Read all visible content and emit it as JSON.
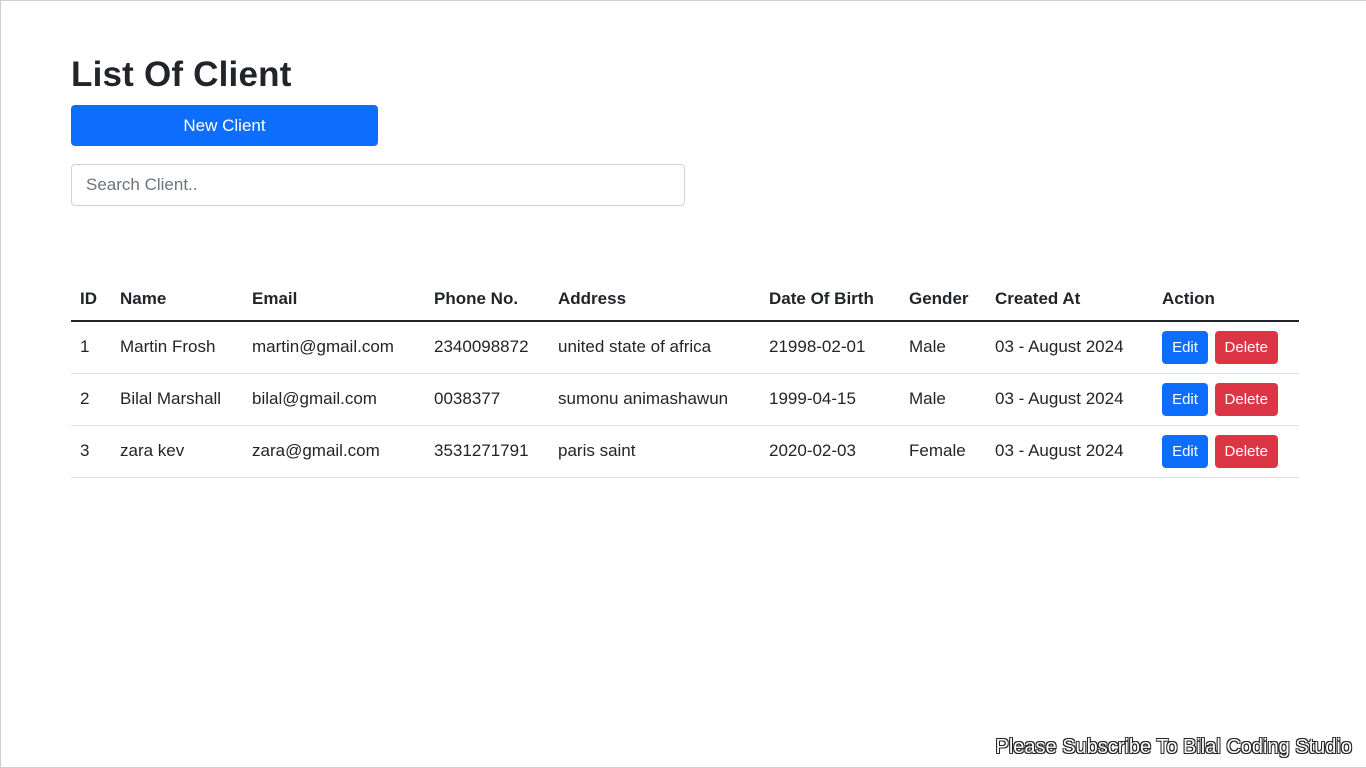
{
  "page": {
    "title": "List Of Client",
    "new_button_label": "New Client",
    "search_placeholder": "Search Client.."
  },
  "colors": {
    "primary": "#0d6efd",
    "danger": "#dc3545"
  },
  "table": {
    "headers": [
      "ID",
      "Name",
      "Email",
      "Phone No.",
      "Address",
      "Date Of Birth",
      "Gender",
      "Created At",
      "Action"
    ],
    "rows": [
      {
        "id": "1",
        "name": "Martin Frosh",
        "email": "martin@gmail.com",
        "phone": "2340098872",
        "address": "united state of africa",
        "dob": "21998-02-01",
        "gender": "Male",
        "created_at": "03 - August 2024"
      },
      {
        "id": "2",
        "name": "Bilal Marshall",
        "email": "bilal@gmail.com",
        "phone": "0038377",
        "address": "sumonu animashawun",
        "dob": "1999-04-15",
        "gender": "Male",
        "created_at": "03 - August 2024"
      },
      {
        "id": "3",
        "name": "zara kev",
        "email": "zara@gmail.com",
        "phone": "3531271791",
        "address": "paris saint",
        "dob": "2020-02-03",
        "gender": "Female",
        "created_at": "03 - August 2024"
      }
    ],
    "edit_label": "Edit",
    "delete_label": "Delete"
  },
  "watermark": "Please Subscribe To Bilal Coding Studio"
}
